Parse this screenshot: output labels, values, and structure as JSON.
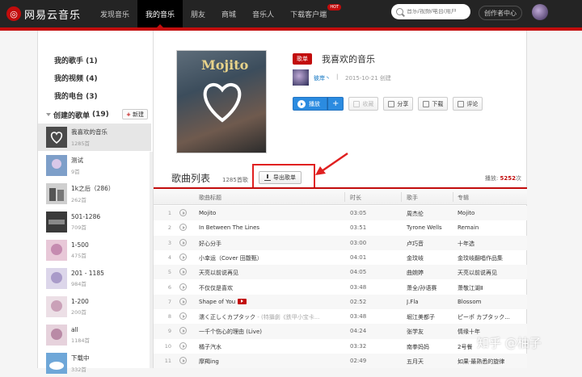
{
  "header": {
    "logo_mark": "◎",
    "logo_text": "网易云音乐",
    "nav": [
      "发现音乐",
      "我的音乐",
      "朋友",
      "商城",
      "音乐人",
      "下载客户端"
    ],
    "hot_badge": "HOT",
    "search_placeholder": "音乐/视频/电台/用户",
    "creator_center": "创作者中心"
  },
  "sidebar": {
    "my_artists": "我的歌手 (1)",
    "my_videos": "我的视频 (4)",
    "my_radio": "我的电台 (3)",
    "created_playlists": "创建的歌单",
    "created_count": "(19)",
    "new_button": "新建",
    "new_plus": "+",
    "playlists": [
      {
        "name": "我喜欢的音乐",
        "count": "1285首"
      },
      {
        "name": "测试",
        "count": "9首"
      },
      {
        "name": "1k之后（286）",
        "count": "262首"
      },
      {
        "name": "501-1286",
        "count": "709首"
      },
      {
        "name": "1-500",
        "count": "475首"
      },
      {
        "name": "201 - 1185",
        "count": "984首"
      },
      {
        "name": "1-200",
        "count": "200首"
      },
      {
        "name": "all",
        "count": "1184首"
      },
      {
        "name": "下载中",
        "count": "332首"
      }
    ]
  },
  "playlist": {
    "cover_title": "Mojito",
    "tag": "歌单",
    "title": "我喜欢的音乐",
    "owner": "彼岸丶",
    "separator": "|",
    "created": "2015-10-21 创建",
    "buttons": {
      "play": "播放",
      "add": "+",
      "collect": "收藏",
      "share": "分享",
      "download": "下载",
      "comment": "评论"
    }
  },
  "song_list": {
    "title": "歌曲列表",
    "count": "1285首歌",
    "export_button": "导出歌单",
    "plays_label": "播放:",
    "plays_value": "5252",
    "plays_unit": "次",
    "columns": [
      "歌曲标题",
      "时长",
      "歌手",
      "专辑"
    ],
    "rows": [
      {
        "num": "1",
        "title": "Mojito",
        "sub": "",
        "time": "03:05",
        "artist": "周杰伦",
        "album": "Mojito"
      },
      {
        "num": "2",
        "title": "In Between The Lines",
        "sub": "",
        "time": "03:51",
        "artist": "Tyrone Wells",
        "album": "Remain"
      },
      {
        "num": "3",
        "title": "好心分手",
        "sub": "",
        "time": "03:00",
        "artist": "卢巧音",
        "album": "十年选"
      },
      {
        "num": "4",
        "title": "小幸运（Cover 田馥甄）",
        "sub": "",
        "time": "04:01",
        "artist": "金玟岐",
        "album": "金玟岐翻唱作品集"
      },
      {
        "num": "5",
        "title": "天亮以前说再见",
        "sub": "",
        "time": "04:05",
        "artist": "曲婉婷",
        "album": "天亮以前说再见"
      },
      {
        "num": "6",
        "title": "不仅仅是喜欢",
        "sub": "",
        "time": "03:48",
        "artist": "萧全/孙语赛",
        "album": "萧敬江湖Ⅱ"
      },
      {
        "num": "7",
        "title": "Shape of You",
        "sub": "",
        "time": "02:52",
        "artist": "J.Fla",
        "album": "Blossom"
      },
      {
        "num": "8",
        "title": "濡く正しくカプタック",
        "sub": " - (特攝劇《鉄甲小宝卡...",
        "time": "03:48",
        "artist": "堀江美都子",
        "album": "ピーポ カプタック..."
      },
      {
        "num": "9",
        "title": "一千个伤心的理由 (Live)",
        "sub": "",
        "time": "04:24",
        "artist": "张学友",
        "album": "情缘十年"
      },
      {
        "num": "10",
        "title": "橘子汽水",
        "sub": "",
        "time": "03:32",
        "artist": "南拳妈妈",
        "album": "2号餐"
      },
      {
        "num": "11",
        "title": "摩羯ing",
        "sub": "",
        "time": "02:49",
        "artist": "五月天",
        "album": "如果·最熟悉的旋律"
      }
    ]
  },
  "watermark": "知乎 @柚子",
  "colors": {
    "accent": "#c20c0c",
    "topbar": "#242424",
    "play_blue": "#2b8be0"
  }
}
